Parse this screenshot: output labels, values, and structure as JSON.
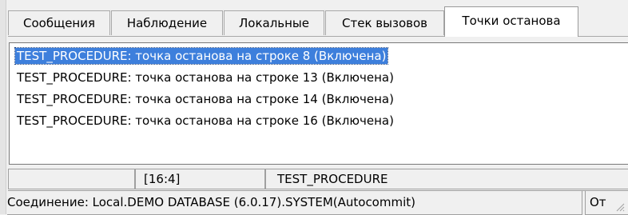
{
  "tabs": [
    {
      "label": "Сообщения",
      "active": false
    },
    {
      "label": "Наблюдение",
      "active": false
    },
    {
      "label": "Локальные",
      "active": false
    },
    {
      "label": "Стек вызовов",
      "active": false
    },
    {
      "label": "Точки останова",
      "active": true
    }
  ],
  "breakpoints": [
    {
      "text": "TEST_PROCEDURE: точка останова на строке 8 (Включена)",
      "selected": true
    },
    {
      "text": "TEST_PROCEDURE: точка останова на строке 13 (Включена)",
      "selected": false
    },
    {
      "text": "TEST_PROCEDURE: точка останова на строке 14 (Включена)",
      "selected": false
    },
    {
      "text": "TEST_PROCEDURE: точка останова на строке 16 (Включена)",
      "selected": false
    }
  ],
  "editor_status": {
    "blank": "",
    "position": "[16:4]",
    "object": "TEST_PROCEDURE"
  },
  "app_status": {
    "connection": "Соединение: Local.DEMO DATABASE (6.0.17).SYSTEM(Autocommit)",
    "extra": "От"
  },
  "colors": {
    "selection": "#3d7fdc",
    "background": "#f0f0f0"
  }
}
